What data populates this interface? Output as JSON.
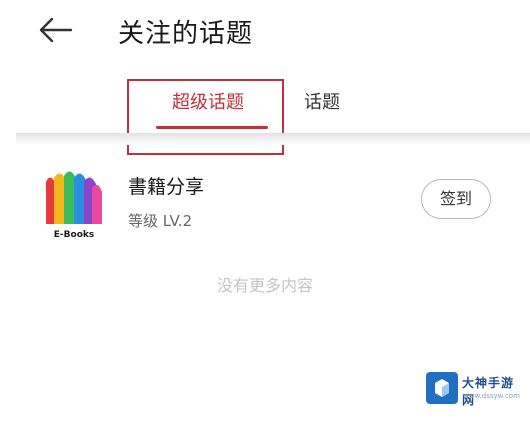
{
  "header": {
    "title": "关注的话题",
    "back_icon": "arrow-left-icon"
  },
  "tabs": [
    {
      "label": "超级话题",
      "active": true
    },
    {
      "label": "话题",
      "active": false
    }
  ],
  "colors": {
    "accent": "#c2313b",
    "watermark_blue": "#1f6fc4"
  },
  "topics": [
    {
      "name": "書籍分享",
      "level": "等级 LV.2",
      "action_label": "签到",
      "logo_icon": "book-logo-icon",
      "logo_text": "E-Books"
    }
  ],
  "footer_text": "没有更多内容",
  "watermark": {
    "name": "大神手游网",
    "url": "www.dssyw.com"
  }
}
